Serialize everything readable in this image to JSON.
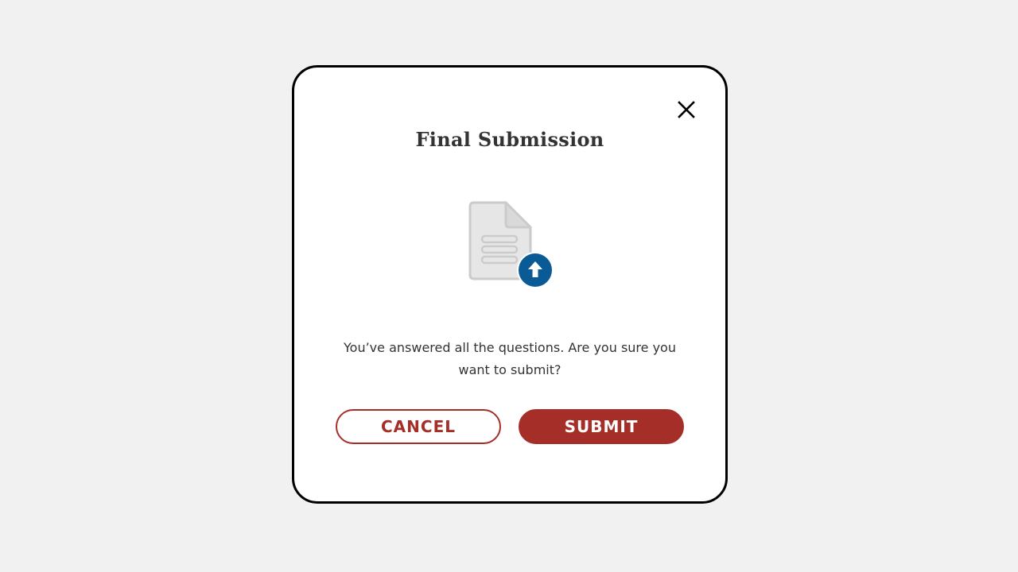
{
  "modal": {
    "title": "Final Submission",
    "message": "You’ve answered all the questions. Are you sure you want to submit?",
    "cancel_label": "CANCEL",
    "submit_label": "SUBMIT",
    "close_icon": "close-icon",
    "illustration_icon": "document-upload-icon"
  },
  "colors": {
    "background": "#f1f1f1",
    "modal_border": "#000000",
    "accent": "#a52e29",
    "upload_badge": "#0a5a96",
    "document_gray": "#cccccc",
    "text": "#333333"
  }
}
